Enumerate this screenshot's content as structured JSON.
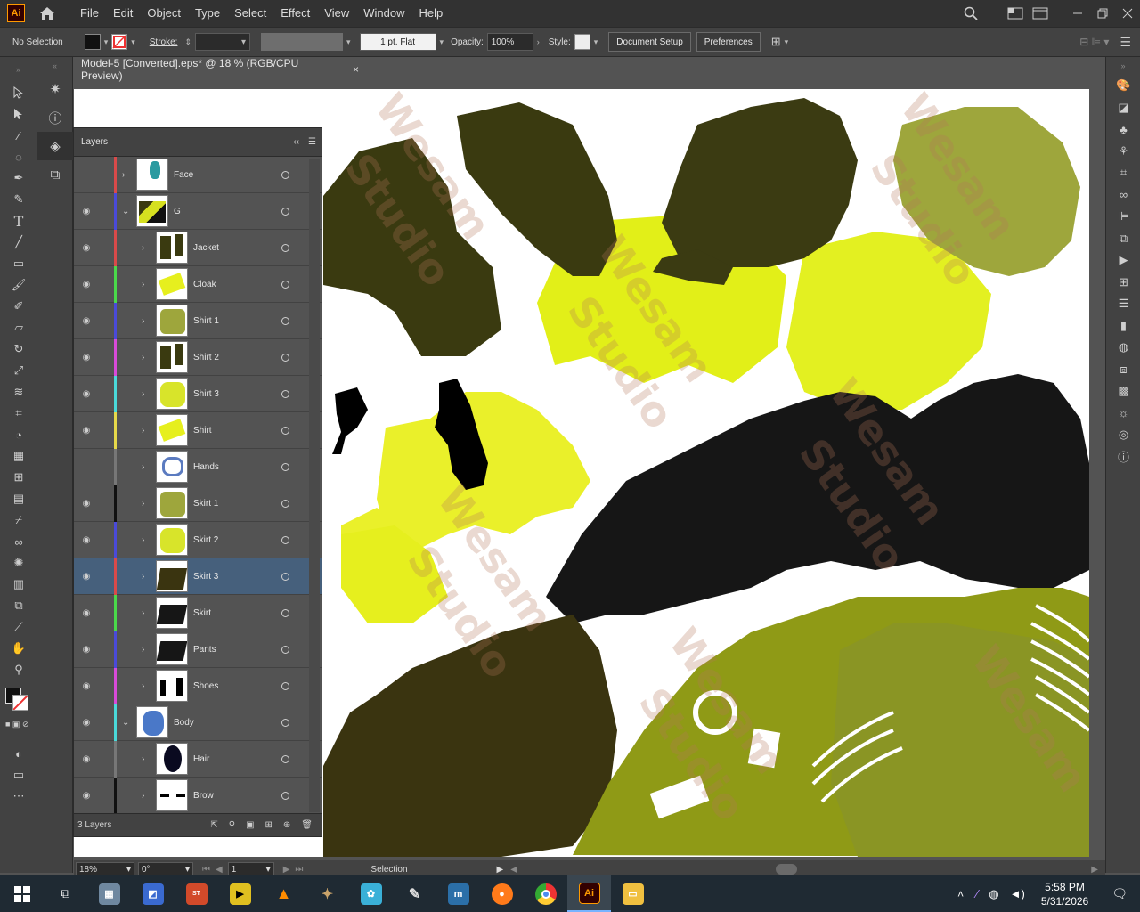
{
  "menubar": {
    "app_logo": "Ai",
    "menus": [
      "File",
      "Edit",
      "Object",
      "Type",
      "Select",
      "Effect",
      "View",
      "Window",
      "Help"
    ]
  },
  "controlbar": {
    "selection": "No Selection",
    "stroke_label": "Stroke:",
    "brush": "1 pt. Flat",
    "opacity_label": "Opacity:",
    "opacity_value": "100%",
    "style_label": "Style:",
    "doc_setup": "Document Setup",
    "preferences": "Preferences"
  },
  "document": {
    "tab_title": "Model-5 [Converted].eps* @ 18 % (RGB/CPU Preview)",
    "close": "×",
    "watermark_1": "Wesam",
    "watermark_2": "Studio"
  },
  "layers_panel": {
    "title": "Layers",
    "footer_count": "3 Layers",
    "rows": [
      {
        "name": "Face",
        "color": "#d94a4a",
        "eye": "",
        "level": 0,
        "expanded": false,
        "thumb": "face"
      },
      {
        "name": "G",
        "color": "#4a4ad9",
        "eye": "◉",
        "level": 0,
        "expanded": true,
        "thumb": "mix"
      },
      {
        "name": "Jacket",
        "color": "#d94a4a",
        "eye": "◉",
        "level": 1,
        "expanded": false,
        "thumb": "dark"
      },
      {
        "name": "Cloak",
        "color": "#4ad94a",
        "eye": "◉",
        "level": 1,
        "expanded": false,
        "thumb": "yellow"
      },
      {
        "name": "Shirt 1",
        "color": "#4a4ad9",
        "eye": "◉",
        "level": 1,
        "expanded": false,
        "thumb": "olive"
      },
      {
        "name": "Shirt 2",
        "color": "#d94ad9",
        "eye": "◉",
        "level": 1,
        "expanded": false,
        "thumb": "dark"
      },
      {
        "name": "Shirt 3",
        "color": "#4ad9d9",
        "eye": "◉",
        "level": 1,
        "expanded": false,
        "thumb": "lime"
      },
      {
        "name": "Shirt",
        "color": "#e6d94a",
        "eye": "◉",
        "level": 1,
        "expanded": false,
        "thumb": "yellow"
      },
      {
        "name": "Hands",
        "color": "#777777",
        "eye": "",
        "level": 1,
        "expanded": false,
        "thumb": "blue"
      },
      {
        "name": "Skirt 1",
        "color": "#111111",
        "eye": "◉",
        "level": 1,
        "expanded": false,
        "thumb": "olive"
      },
      {
        "name": "Skirt 2",
        "color": "#4a4ad9",
        "eye": "◉",
        "level": 1,
        "expanded": false,
        "thumb": "lime"
      },
      {
        "name": "Skirt 3",
        "color": "#d94a4a",
        "eye": "◉",
        "level": 1,
        "expanded": false,
        "thumb": "brown",
        "selected": true
      },
      {
        "name": "Skirt",
        "color": "#4ad94a",
        "eye": "◉",
        "level": 1,
        "expanded": false,
        "thumb": "black"
      },
      {
        "name": "Pants",
        "color": "#4a4ad9",
        "eye": "◉",
        "level": 1,
        "expanded": false,
        "thumb": "black"
      },
      {
        "name": "Shoes",
        "color": "#d94ad9",
        "eye": "◉",
        "level": 1,
        "expanded": false,
        "thumb": "shoes"
      },
      {
        "name": "Body",
        "color": "#4ad9d9",
        "eye": "◉",
        "level": 0,
        "expanded": true,
        "thumb": "body"
      },
      {
        "name": "Hair",
        "color": "#777777",
        "eye": "◉",
        "level": 1,
        "expanded": false,
        "thumb": "hair"
      },
      {
        "name": "Brow",
        "color": "#111111",
        "eye": "◉",
        "level": 1,
        "expanded": false,
        "thumb": "brow"
      }
    ]
  },
  "statusbar": {
    "zoom": "18%",
    "rotation": "0°",
    "artboard": "1",
    "tool": "Selection"
  },
  "taskbar": {
    "time": "5:58 PM",
    "date": "5/31/2026"
  }
}
